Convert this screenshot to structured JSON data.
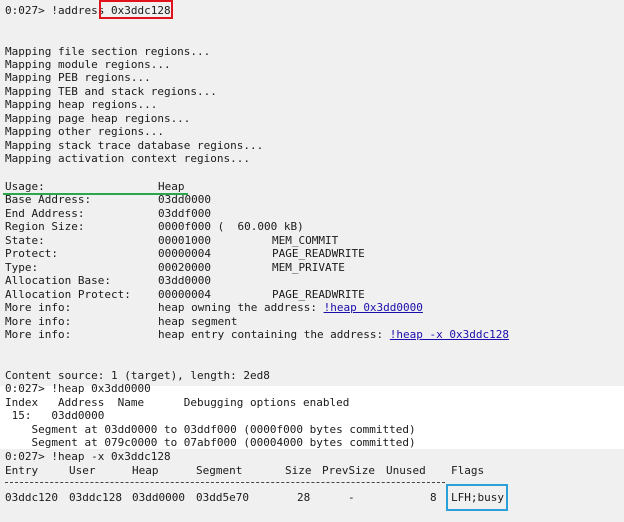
{
  "cmd1": {
    "prompt": "0:027> !address ",
    "arg": "0x3ddc128"
  },
  "mapping": [
    "Mapping file section regions...",
    "Mapping module regions...",
    "Mapping PEB regions...",
    "Mapping TEB and stack regions...",
    "Mapping heap regions...",
    "Mapping page heap regions...",
    "Mapping other regions...",
    "Mapping stack trace database regions...",
    "Mapping activation context regions..."
  ],
  "info": {
    "usage_label": "Usage:",
    "usage_value": "Heap",
    "base_label": "Base Address:",
    "base_value": "03dd0000",
    "end_label": "End Address:",
    "end_value": "03ddf000",
    "size_label": "Region Size:",
    "size_value": "0000f000 (  60.000 kB)",
    "state_label": "State:",
    "state_value": "00001000",
    "state_name": "MEM_COMMIT",
    "protect_label": "Protect:",
    "protect_value": "00000004",
    "protect_name": "PAGE_READWRITE",
    "type_label": "Type:",
    "type_value": "00020000",
    "type_name": "MEM_PRIVATE",
    "allocbase_label": "Allocation Base:",
    "allocbase_value": "03dd0000",
    "allocprot_label": "Allocation Protect:",
    "allocprot_value": "00000004",
    "allocprot_name": "PAGE_READWRITE",
    "more1_label": "More info:",
    "more1_text": "heap owning the address: ",
    "more1_link": "!heap 0x3dd0000",
    "more2_label": "More info:",
    "more2_text": "heap segment",
    "more3_label": "More info:",
    "more3_text": "heap entry containing the address: ",
    "more3_link": "!heap -x 0x3ddc128"
  },
  "content_source": "Content source: 1 (target), length: 2ed8",
  "cmd2": "0:027> !heap 0x3dd0000",
  "heap_header": "Index   Address  Name      Debugging options enabled",
  "heap_row": " 15:   03dd0000",
  "segments": [
    "    Segment at 03dd0000 to 03ddf000 (0000f000 bytes committed)",
    "    Segment at 079c0000 to 07abf000 (00004000 bytes committed)"
  ],
  "cmd3": "0:027> !heap -x 0x3ddc128",
  "entry_headers": [
    "Entry",
    "User",
    "Heap",
    "Segment",
    "Size",
    "PrevSize",
    "Unused",
    "Flags"
  ],
  "entry_row": [
    "03ddc120",
    "03ddc128",
    "03dd0000",
    "03dd5e70",
    "28",
    "-",
    "8",
    "LFH;busy"
  ]
}
